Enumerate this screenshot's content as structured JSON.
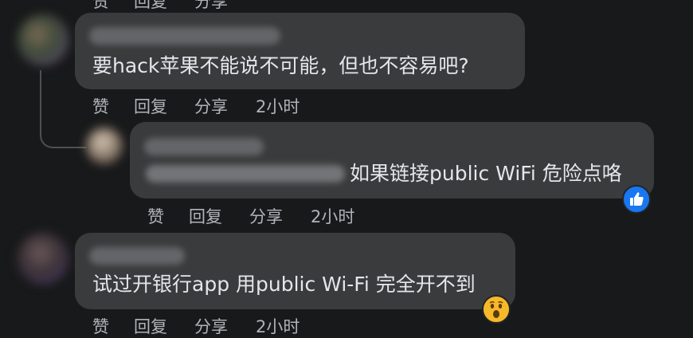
{
  "actions": {
    "like": "赞",
    "reply": "回复",
    "share": "分享"
  },
  "comments": [
    {
      "author": "",
      "text": "要hack苹果不能说不可能，但也不容易吧?",
      "time": "2小时"
    },
    {
      "author": "",
      "mention": "",
      "text": "如果链接public WiFi 危险点咯",
      "time": "2小时",
      "reaction": "like"
    },
    {
      "author": "",
      "text": "试过开银行app 用public Wi-Fi 完全开不到",
      "time": "2小时",
      "reaction": "wow"
    }
  ],
  "colors": {
    "background": "#18191a",
    "bubble": "#3a3b3c",
    "text": "#e4e6eb",
    "meta": "#b0b3b8",
    "like_blue": "#1877f2",
    "wow_yellow": "#f7b928"
  }
}
